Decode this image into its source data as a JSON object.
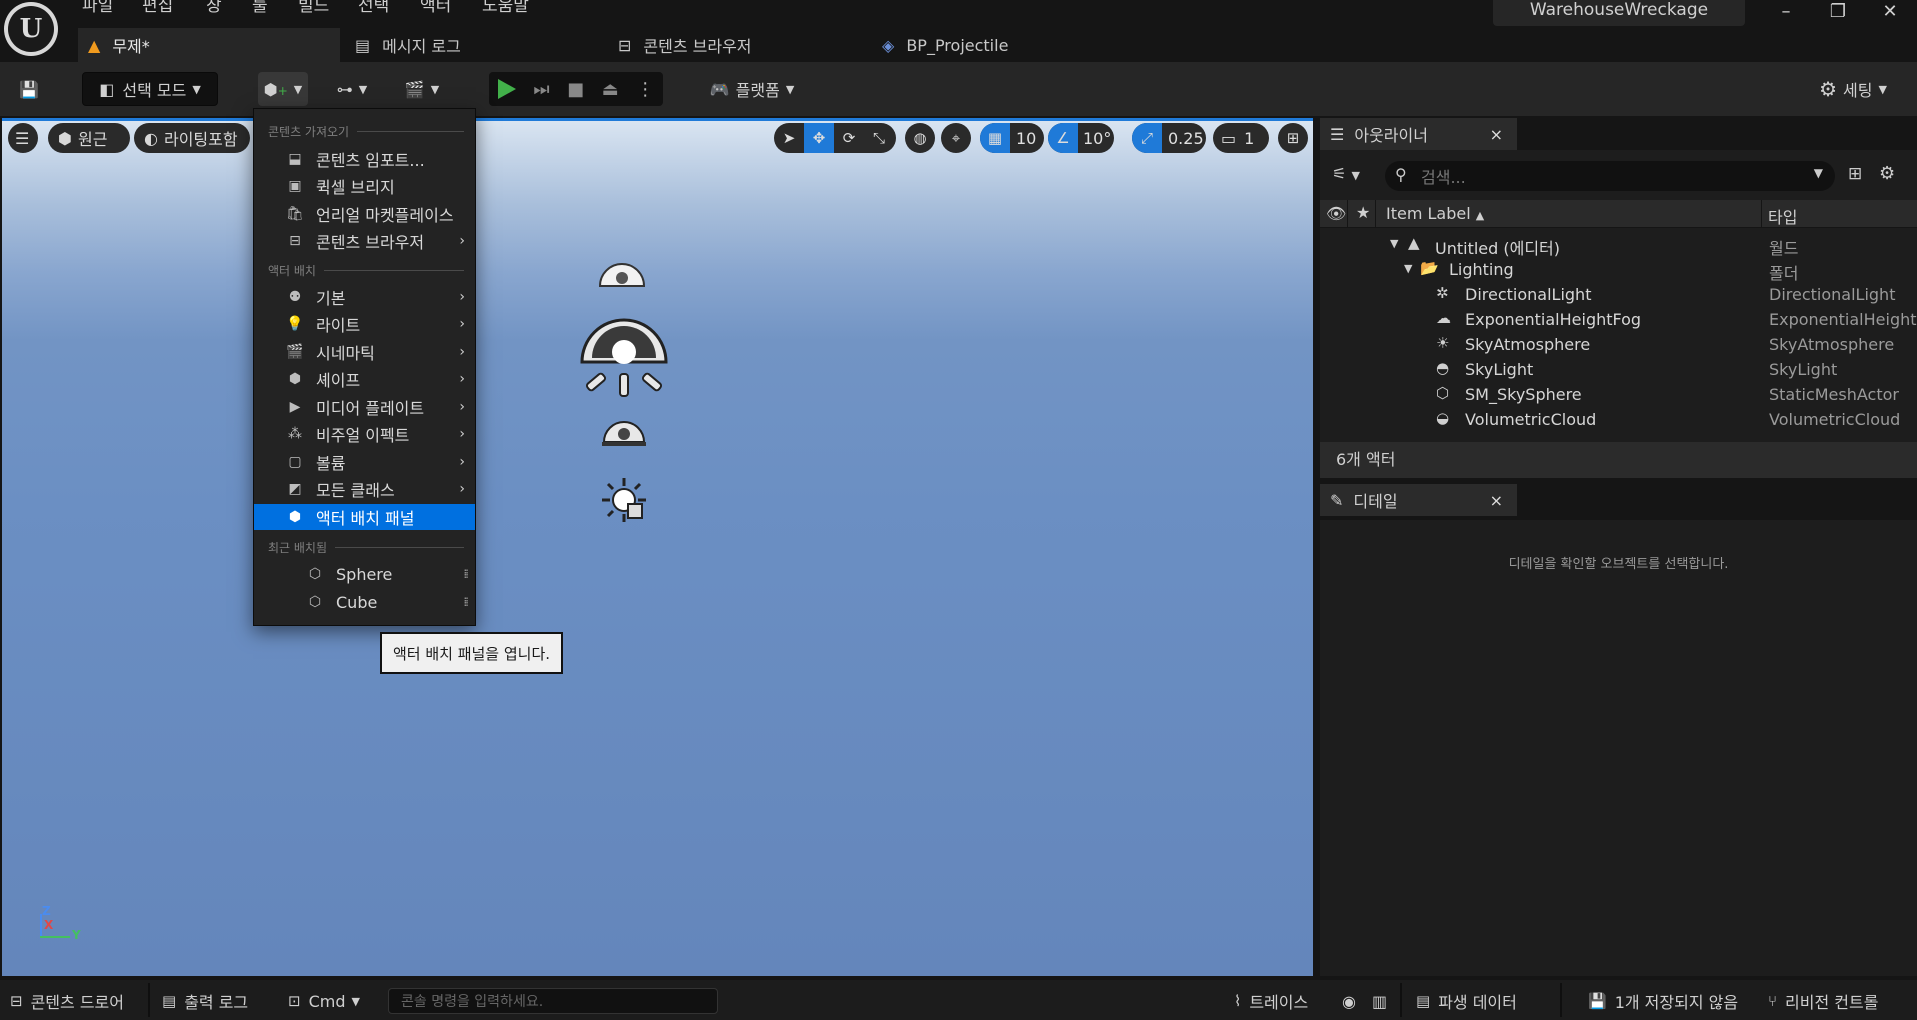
{
  "menu": [
    "파일",
    "편집",
    "창",
    "툴",
    "빌드",
    "선택",
    "액터",
    "도움말"
  ],
  "project_name": "WarehouseWreckage",
  "window_controls": {
    "minimize": "–",
    "restore": "❐",
    "close": "✕"
  },
  "doc_tabs": [
    {
      "label": "무제*",
      "icon": "level-icon"
    },
    {
      "label": "메시지 로그",
      "icon": "log-icon"
    },
    {
      "label": "콘텐츠 브라우저",
      "icon": "content-browser-icon"
    },
    {
      "label": "BP_Projectile",
      "icon": "blueprint-icon"
    }
  ],
  "toolbar": {
    "mode_label": "선택 모드",
    "platform_label": "플랫폼",
    "settings_label": "세팅"
  },
  "viewport": {
    "perspective_label": "원근",
    "lighting_label": "라이팅포함",
    "grid_snap": "10",
    "rotation_snap": "10°",
    "scale_snap": "0.25",
    "camera_speed": "1",
    "axis": {
      "z": "Z",
      "x": "X",
      "y": "Y"
    }
  },
  "dropdown": {
    "section_import": "콘텐츠 가져오기",
    "import_items": [
      {
        "label": "콘텐츠 임포트...",
        "icon": "import-icon"
      },
      {
        "label": "퀵셀 브리지",
        "icon": "bridge-icon"
      },
      {
        "label": "언리얼 마켓플레이스",
        "icon": "marketplace-icon"
      },
      {
        "label": "콘텐츠 브라우저",
        "icon": "content-browser-icon"
      }
    ],
    "section_place": "액터 배치",
    "place_items": [
      {
        "label": "기본"
      },
      {
        "label": "라이트"
      },
      {
        "label": "시네마틱"
      },
      {
        "label": "셰이프"
      },
      {
        "label": "미디어 플레이트"
      },
      {
        "label": "비주얼 이펙트"
      },
      {
        "label": "볼륨"
      },
      {
        "label": "모든 클래스"
      }
    ],
    "highlighted_item": "액터 배치 패널",
    "section_recent": "최근 배치됨",
    "recent_items": [
      "Sphere",
      "Cube"
    ]
  },
  "tooltip": "액터 배치 패널을 엽니다.",
  "outliner": {
    "tab_label": "아웃라이너",
    "search_placeholder": "검색...",
    "col_label": "Item Label",
    "col_type": "타입",
    "rows": [
      {
        "label": "Untitled (에디터)",
        "type": "월드"
      },
      {
        "label": "Lighting",
        "type": "폴더"
      },
      {
        "label": "DirectionalLight",
        "type": "DirectionalLight"
      },
      {
        "label": "ExponentialHeightFog",
        "type": "ExponentialHeight"
      },
      {
        "label": "SkyAtmosphere",
        "type": "SkyAtmosphere"
      },
      {
        "label": "SkyLight",
        "type": "SkyLight"
      },
      {
        "label": "SM_SkySphere",
        "type": "StaticMeshActor"
      },
      {
        "label": "VolumetricCloud",
        "type": "VolumetricCloud"
      }
    ],
    "actor_count": "6개 액터"
  },
  "details": {
    "tab_label": "디테일",
    "hint": "디테일을 확인할 오브젝트를 선택합니다."
  },
  "statusbar": {
    "content_drawer": "콘텐츠 드로어",
    "output_log": "출력 로그",
    "cmd": "Cmd",
    "console_placeholder": "콘솔 명령을 입력하세요.",
    "trace": "트레이스",
    "derived_data": "파생 데이터",
    "unsaved": "1개 저장되지 않음",
    "revision_control": "리비전 컨트롤"
  },
  "colors": {
    "accent": "#0070e0",
    "play": "#42b04a",
    "panel": "#262626",
    "background": "#151515"
  }
}
